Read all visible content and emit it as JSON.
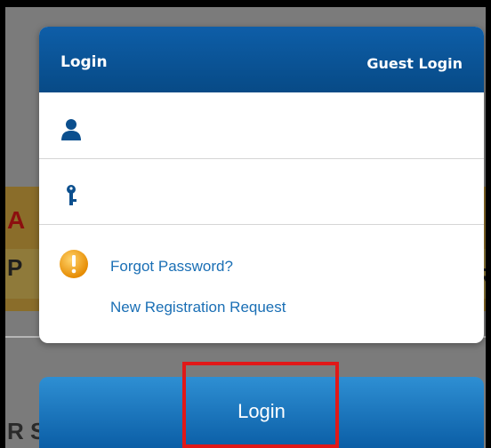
{
  "header": {
    "login_tab": "Login",
    "guest_tab": "Guest Login"
  },
  "fields": {
    "username": {
      "value": "",
      "placeholder": ""
    },
    "password": {
      "value": "",
      "placeholder": ""
    }
  },
  "links": {
    "forgot_password": "Forgot Password?",
    "new_registration": "New Registration Request"
  },
  "submit": {
    "label": "Login"
  },
  "icons": {
    "username": "user-icon",
    "password": "key-icon",
    "warning": "warning-icon"
  },
  "colors": {
    "header": "#0b5498",
    "button": "#1c77c0",
    "link": "#1a6fb5",
    "highlight": "#e01818",
    "warning": "#f5a623"
  }
}
